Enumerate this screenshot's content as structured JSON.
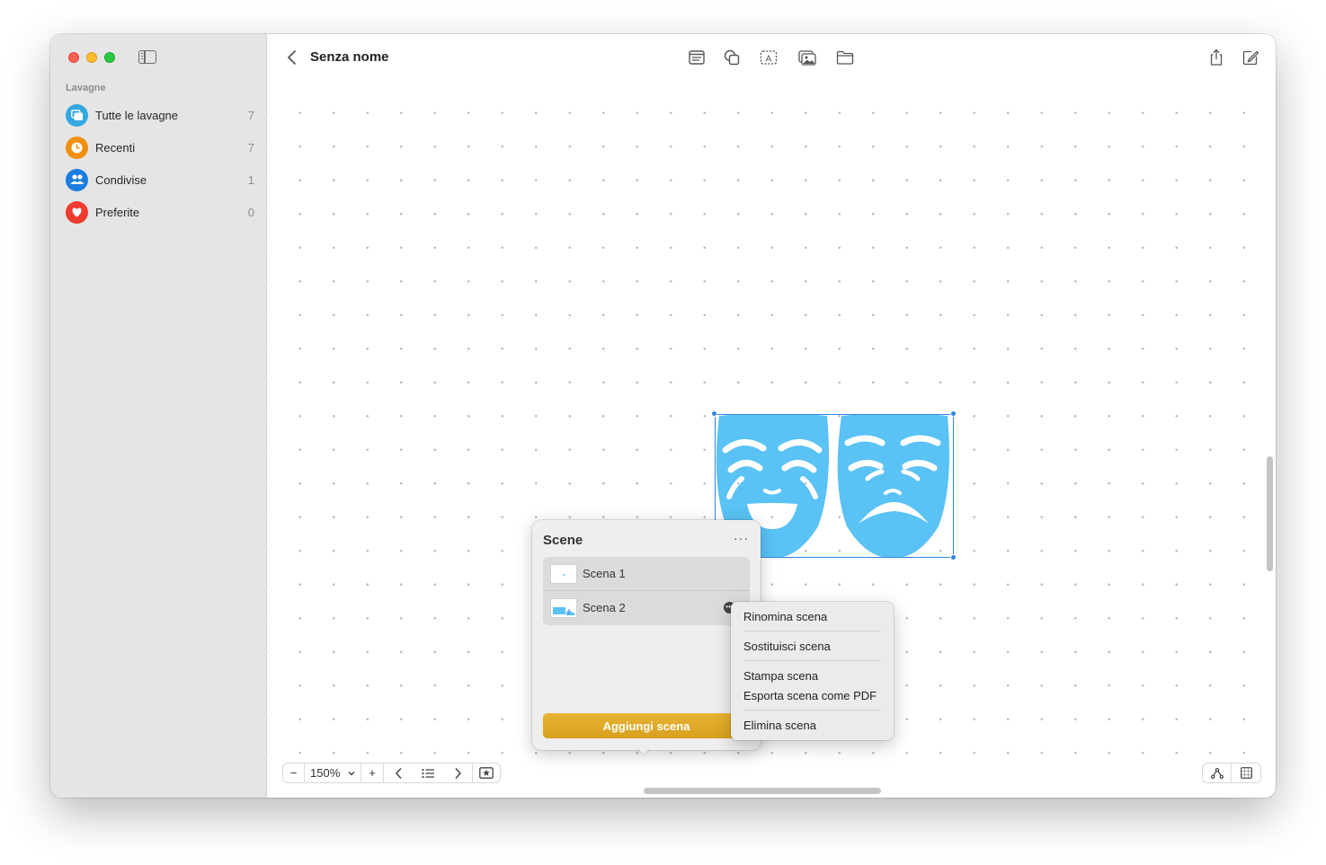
{
  "sidebar": {
    "section_label": "Lavagne",
    "items": [
      {
        "label": "Tutte le lavagne",
        "count": "7",
        "icon": "boards-icon",
        "color": "#33a8e0"
      },
      {
        "label": "Recenti",
        "count": "7",
        "icon": "clock-icon",
        "color": "#f1900e"
      },
      {
        "label": "Condivise",
        "count": "1",
        "icon": "people-icon",
        "color": "#1b7de0"
      },
      {
        "label": "Preferite",
        "count": "0",
        "icon": "heart-icon",
        "color": "#ef3b30"
      }
    ]
  },
  "titlebar": {
    "title": "Senza nome",
    "tools": [
      "note-icon",
      "shapes-icon",
      "text-box-icon",
      "media-icon",
      "folder-icon"
    ],
    "right_tools": [
      "share-icon",
      "compose-icon"
    ]
  },
  "canvas": {
    "object": "theater-masks-icon",
    "object_color": "#5ac2f5",
    "selection_color": "#2f85e6"
  },
  "bottombar": {
    "zoom_out": "−",
    "zoom": "150%",
    "zoom_in": "+",
    "prev": "‹",
    "scenes_list": "list-icon",
    "next": "›",
    "scene_star": "star-box-icon",
    "right_tools": [
      "diagram-icon",
      "grid-icon"
    ]
  },
  "scenes_popover": {
    "title": "Scene",
    "more": "···",
    "scenes": [
      {
        "name": "Scena 1"
      },
      {
        "name": "Scena 2"
      }
    ],
    "add_button": "Aggiungi scena",
    "accent": "#dba524"
  },
  "context_menu": {
    "groups": [
      [
        "Rinomina scena"
      ],
      [
        "Sostituisci scena"
      ],
      [
        "Stampa scena",
        "Esporta scena come PDF"
      ],
      [
        "Elimina scena"
      ]
    ]
  }
}
